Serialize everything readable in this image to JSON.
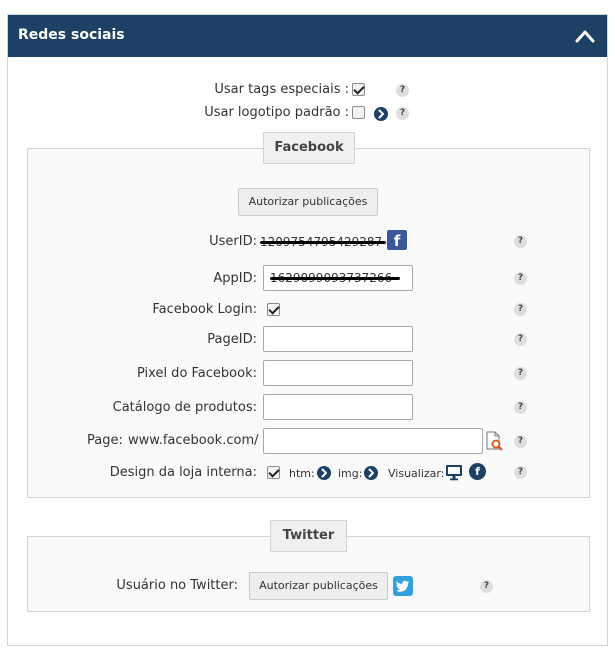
{
  "panel": {
    "title": "Redes sociais"
  },
  "general": {
    "special_tags_label": "Usar tags especiais :",
    "special_tags_checked": true,
    "default_logo_label": "Usar logotipo padrão :",
    "default_logo_checked": false,
    "help_glyph": "?"
  },
  "facebook": {
    "legend": "Facebook",
    "authorize_button": "Autorizar publicações",
    "userid_label": "UserID:",
    "userid_value": "1209754795429287",
    "appid_label": "AppID:",
    "appid_value": "1629099093737266",
    "login_label": "Facebook Login:",
    "login_checked": true,
    "pageid_label": "PageID:",
    "pageid_value": "",
    "pixel_label": "Pixel do Facebook:",
    "pixel_value": "",
    "catalog_label": "Catálogo de produtos:",
    "catalog_value": "",
    "page_label": "Page:",
    "page_prefix": "www.facebook.com/",
    "page_value": "",
    "design_label": "Design da loja interna:",
    "design_checked": true,
    "htm_label": "htm:",
    "img_label": "img:",
    "view_label": "Visualizar:",
    "fb_glyph": "f"
  },
  "twitter": {
    "legend": "Twitter",
    "user_label": "Usuário no Twitter:",
    "authorize_button": "Autorizar publicações"
  },
  "icons": {
    "collapse": "chevron-up-icon",
    "help": "help-icon",
    "arrow": "arrow-right-circle-icon",
    "search_page": "page-search-icon",
    "monitor": "monitor-icon",
    "facebook": "facebook-icon",
    "twitter": "twitter-icon"
  },
  "colors": {
    "header_bg": "#1c4164",
    "facebook_blue": "#3b5998",
    "twitter_blue": "#33a0dc"
  }
}
